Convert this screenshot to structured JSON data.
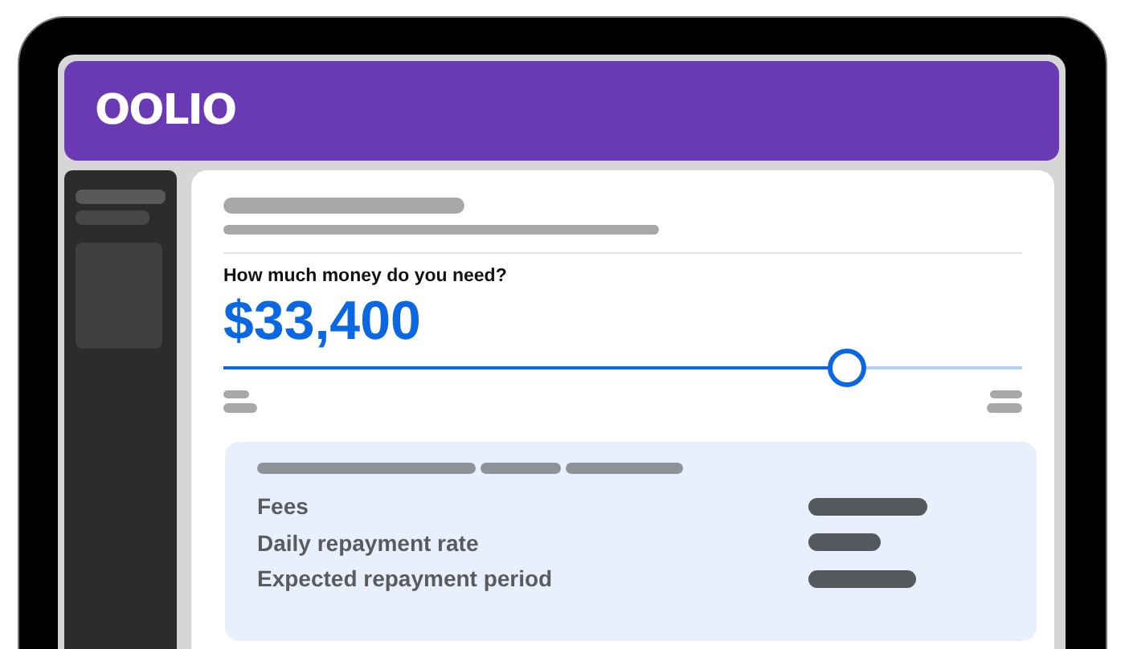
{
  "logo": "OOLIO",
  "amount_prompt": "How much money do you need?",
  "amount": "$33,400",
  "slider": {
    "level": 0.78
  },
  "summary": {
    "rows": [
      {
        "label": "Fees"
      },
      {
        "label": "Daily repayment rate"
      },
      {
        "label": "Expected repayment period"
      }
    ]
  }
}
